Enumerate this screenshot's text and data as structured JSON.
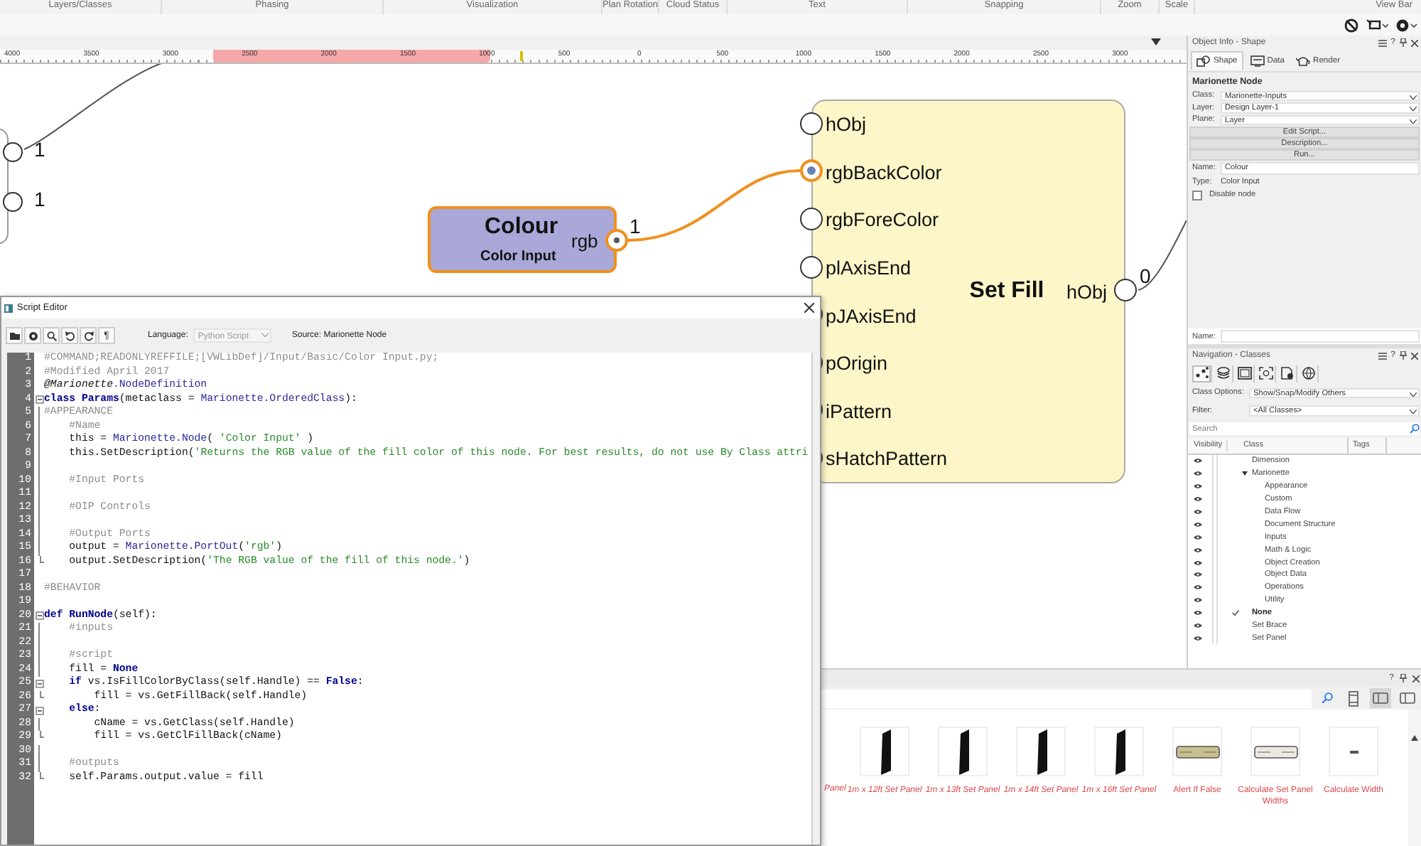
{
  "menu_bar": {
    "groups": [
      "Layers/Classes",
      "Phasing",
      "Visualization",
      "Plan Rotation",
      "Cloud Status",
      "Text",
      "Snapping",
      "Zoom",
      "Scale",
      "View Bar"
    ]
  },
  "ruler": {
    "labels": [
      "4000",
      "3500",
      "3000",
      "2500",
      "2000",
      "1500",
      "1000",
      "500",
      "0",
      "500",
      "1000",
      "1500",
      "2000",
      "2500",
      "3000"
    ]
  },
  "canvas": {
    "left_node": {
      "outputs": [
        "1",
        "1"
      ]
    },
    "input_node": {
      "title": "Colour",
      "subtitle": "Color Input",
      "port": "rgb",
      "count": "1",
      "selected": true
    },
    "fill_node": {
      "title": "Set Fill",
      "output": "hObj",
      "count": "0",
      "inputs": [
        {
          "label": "hObj",
          "selected": false
        },
        {
          "label": "rgbBackColor",
          "selected": true
        },
        {
          "label": "rgbForeColor",
          "selected": false
        },
        {
          "label": "plAxisEnd",
          "selected": false
        },
        {
          "label": "pJAxisEnd",
          "selected": false
        },
        {
          "label": "pOrigin",
          "selected": false
        },
        {
          "label": "iPattern",
          "selected": false
        },
        {
          "label": "sHatchPattern",
          "selected": false
        }
      ]
    }
  },
  "object_info": {
    "title": "Object Info - Shape",
    "help": "?",
    "tabs": [
      {
        "label": "Shape",
        "selected": true
      },
      {
        "label": "Data",
        "selected": false
      },
      {
        "label": "Render",
        "selected": false
      }
    ],
    "heading": "Marionette Node",
    "dropdowns": [
      {
        "label": "Class:",
        "value": "Marionette-Inputs"
      },
      {
        "label": "Layer:",
        "value": "Design Layer-1"
      },
      {
        "label": "Plane:",
        "value": "Layer"
      }
    ],
    "buttons": [
      "Edit Script...",
      "Description...",
      "Run..."
    ],
    "name": {
      "label": "Name:",
      "value": "Colour"
    },
    "type": {
      "label": "Type:",
      "value": "Color Input"
    },
    "disable_node": {
      "label": "Disable node",
      "checked": false
    },
    "footer_name": {
      "label": "Name:"
    }
  },
  "navigation": {
    "title": "Navigation - Classes",
    "help": "?",
    "tabs": [
      {
        "selected": true
      },
      {
        "selected": false
      },
      {
        "selected": false
      },
      {
        "selected": false
      },
      {
        "selected": false
      },
      {
        "selected": false
      }
    ],
    "class_options": {
      "label": "Class Options:",
      "value": "Show/Snap/Modify Others"
    },
    "filter": {
      "label": "Filter:",
      "value": "<All Classes>"
    },
    "search": {
      "placeholder": "Search"
    },
    "columns": [
      "Visibility",
      "Class",
      "Tags"
    ],
    "classes": [
      {
        "name": "Dimension",
        "active": false
      },
      {
        "name": "Marionette",
        "active": false,
        "expanded": true,
        "children": [
          {
            "name": "Appearance",
            "active": false
          },
          {
            "name": "Custom",
            "active": false
          },
          {
            "name": "Data Flow",
            "active": false
          },
          {
            "name": "Document Structure",
            "active": false
          },
          {
            "name": "Inputs",
            "active": false
          },
          {
            "name": "Math & Logic",
            "active": false
          },
          {
            "name": "Object Creation",
            "active": false
          },
          {
            "name": "Object Data",
            "active": false
          },
          {
            "name": "Operations",
            "active": false
          },
          {
            "name": "Utility",
            "active": false
          }
        ]
      },
      {
        "name": "None",
        "active": true
      },
      {
        "name": "Set Brace",
        "active": false
      },
      {
        "name": "Set Panel",
        "active": false
      }
    ]
  },
  "library": {
    "help": "?",
    "view_modes": [
      {
        "selected": false
      },
      {
        "selected": true
      },
      {
        "selected": false
      }
    ],
    "items": [
      {
        "label": "Panel",
        "kind": "partial"
      },
      {
        "label": "1m x 12ft Set Panel",
        "kind": "panel"
      },
      {
        "label": "1m x 13ft Set Panel",
        "kind": "panel"
      },
      {
        "label": "1m x 14ft Set Panel",
        "kind": "panel"
      },
      {
        "label": "1m x 16ft Set Panel",
        "kind": "panel"
      },
      {
        "label": "Alert If False",
        "kind": "node"
      },
      {
        "label": "Calculate Set Panel Widths",
        "kind": "node"
      },
      {
        "label": "Calculate Width",
        "kind": "dash"
      }
    ]
  },
  "script_editor": {
    "title": "Script Editor",
    "toolbar_glyph": "¶",
    "language": {
      "label": "Language:",
      "value": "Python Script"
    },
    "source": "Source: Marionette Node",
    "lines": [
      {
        "number": "1",
        "tokens": [
          {
            "kind": "comment",
            "text": "#COMMAND;READONLYREFFILE;[VWLibDef]/Input/Basic/Color Input.py;"
          }
        ]
      },
      {
        "number": "2",
        "tokens": [
          {
            "kind": "comment",
            "text": "#Modified April 2017"
          }
        ]
      },
      {
        "number": "3",
        "tokens": [
          {
            "kind": "decorator",
            "text": "@Marionette"
          },
          {
            "kind": "type",
            "text": ".NodeDefinition"
          }
        ]
      },
      {
        "number": "4",
        "kind": "start",
        "tokens": [
          {
            "kind": "keyword",
            "text": "class Params"
          },
          {
            "kind": "plain",
            "text": "(metaclass = "
          },
          {
            "kind": "type",
            "text": "Marionette.OrderedClass"
          },
          {
            "kind": "plain",
            "text": "):"
          }
        ]
      },
      {
        "number": "5",
        "kind": "mid",
        "tokens": [
          {
            "kind": "comment",
            "text": "#APPEARANCE"
          }
        ]
      },
      {
        "number": "6",
        "kind": "mid",
        "tokens": [
          {
            "kind": "comment",
            "text": "    #Name"
          }
        ]
      },
      {
        "number": "7",
        "kind": "mid",
        "tokens": [
          {
            "kind": "plain",
            "text": "    this = "
          },
          {
            "kind": "type",
            "text": "Marionette.Node"
          },
          {
            "kind": "plain",
            "text": "( "
          },
          {
            "kind": "string",
            "text": "'Color Input'"
          },
          {
            "kind": "plain",
            "text": " )"
          }
        ]
      },
      {
        "number": "8",
        "kind": "mid",
        "tokens": [
          {
            "kind": "plain",
            "text": "    this.SetDescription("
          },
          {
            "kind": "string",
            "text": "'Returns the RGB value of the fill color of this node. For best results, do not use By Class attri"
          }
        ]
      },
      {
        "number": "9",
        "kind": "mid"
      },
      {
        "number": "10",
        "kind": "mid",
        "tokens": [
          {
            "kind": "comment",
            "text": "    #Input Ports"
          }
        ]
      },
      {
        "number": "11",
        "kind": "mid"
      },
      {
        "number": "12",
        "kind": "mid",
        "tokens": [
          {
            "kind": "comment",
            "text": "    #OIP Controls"
          }
        ]
      },
      {
        "number": "13",
        "kind": "mid"
      },
      {
        "number": "14",
        "kind": "mid",
        "tokens": [
          {
            "kind": "comment",
            "text": "    #Output Ports"
          }
        ]
      },
      {
        "number": "15",
        "kind": "mid",
        "tokens": [
          {
            "kind": "plain",
            "text": "    output = "
          },
          {
            "kind": "type",
            "text": "Marionette.PortOut"
          },
          {
            "kind": "plain",
            "text": "("
          },
          {
            "kind": "string",
            "text": "'rgb'"
          },
          {
            "kind": "plain",
            "text": ")"
          }
        ]
      },
      {
        "number": "16",
        "kind": "end",
        "tokens": [
          {
            "kind": "plain",
            "text": "    output.SetDescription("
          },
          {
            "kind": "string",
            "text": "'The RGB value of the fill of this node.'"
          },
          {
            "kind": "plain",
            "text": ")"
          }
        ]
      },
      {
        "number": "17"
      },
      {
        "number": "18",
        "tokens": [
          {
            "kind": "comment",
            "text": "#BEHAVIOR"
          }
        ]
      },
      {
        "number": "19"
      },
      {
        "number": "20",
        "kind": "start",
        "tokens": [
          {
            "kind": "keyword",
            "text": "def RunNode"
          },
          {
            "kind": "plain",
            "text": "(self):"
          }
        ]
      },
      {
        "number": "21",
        "kind": "mid",
        "tokens": [
          {
            "kind": "comment",
            "text": "    #inputs"
          }
        ]
      },
      {
        "number": "22",
        "kind": "mid"
      },
      {
        "number": "23",
        "kind": "mid",
        "tokens": [
          {
            "kind": "comment",
            "text": "    #script"
          }
        ]
      },
      {
        "number": "24",
        "kind": "mid",
        "tokens": [
          {
            "kind": "plain",
            "text": "    fill = "
          },
          {
            "kind": "keyword",
            "text": "None"
          }
        ]
      },
      {
        "number": "25",
        "kind": "start",
        "tokens": [
          {
            "kind": "keyword",
            "text": "    if"
          },
          {
            "kind": "plain",
            "text": " vs.IsFillColorByClass(self.Handle) == "
          },
          {
            "kind": "keyword",
            "text": "False"
          },
          {
            "kind": "plain",
            "text": ":"
          }
        ]
      },
      {
        "number": "26",
        "kind": "end",
        "tokens": [
          {
            "kind": "plain",
            "text": "        fill = vs.GetFillBack(self.Handle)"
          }
        ]
      },
      {
        "number": "27",
        "kind": "start",
        "tokens": [
          {
            "kind": "keyword",
            "text": "    else"
          },
          {
            "kind": "plain",
            "text": ":"
          }
        ]
      },
      {
        "number": "28",
        "kind": "mid",
        "tokens": [
          {
            "kind": "plain",
            "text": "        cName = vs.GetClass(self.Handle)"
          }
        ]
      },
      {
        "number": "29",
        "kind": "end",
        "tokens": [
          {
            "kind": "plain",
            "text": "        fill = vs.GetClFillBack(cName)"
          }
        ]
      },
      {
        "number": "30",
        "kind": "mid"
      },
      {
        "number": "31",
        "kind": "mid",
        "tokens": [
          {
            "kind": "comment",
            "text": "    #outputs"
          }
        ]
      },
      {
        "number": "32",
        "kind": "end",
        "tokens": [
          {
            "kind": "plain",
            "text": "    self.Params.output.value = fill"
          }
        ]
      }
    ]
  }
}
